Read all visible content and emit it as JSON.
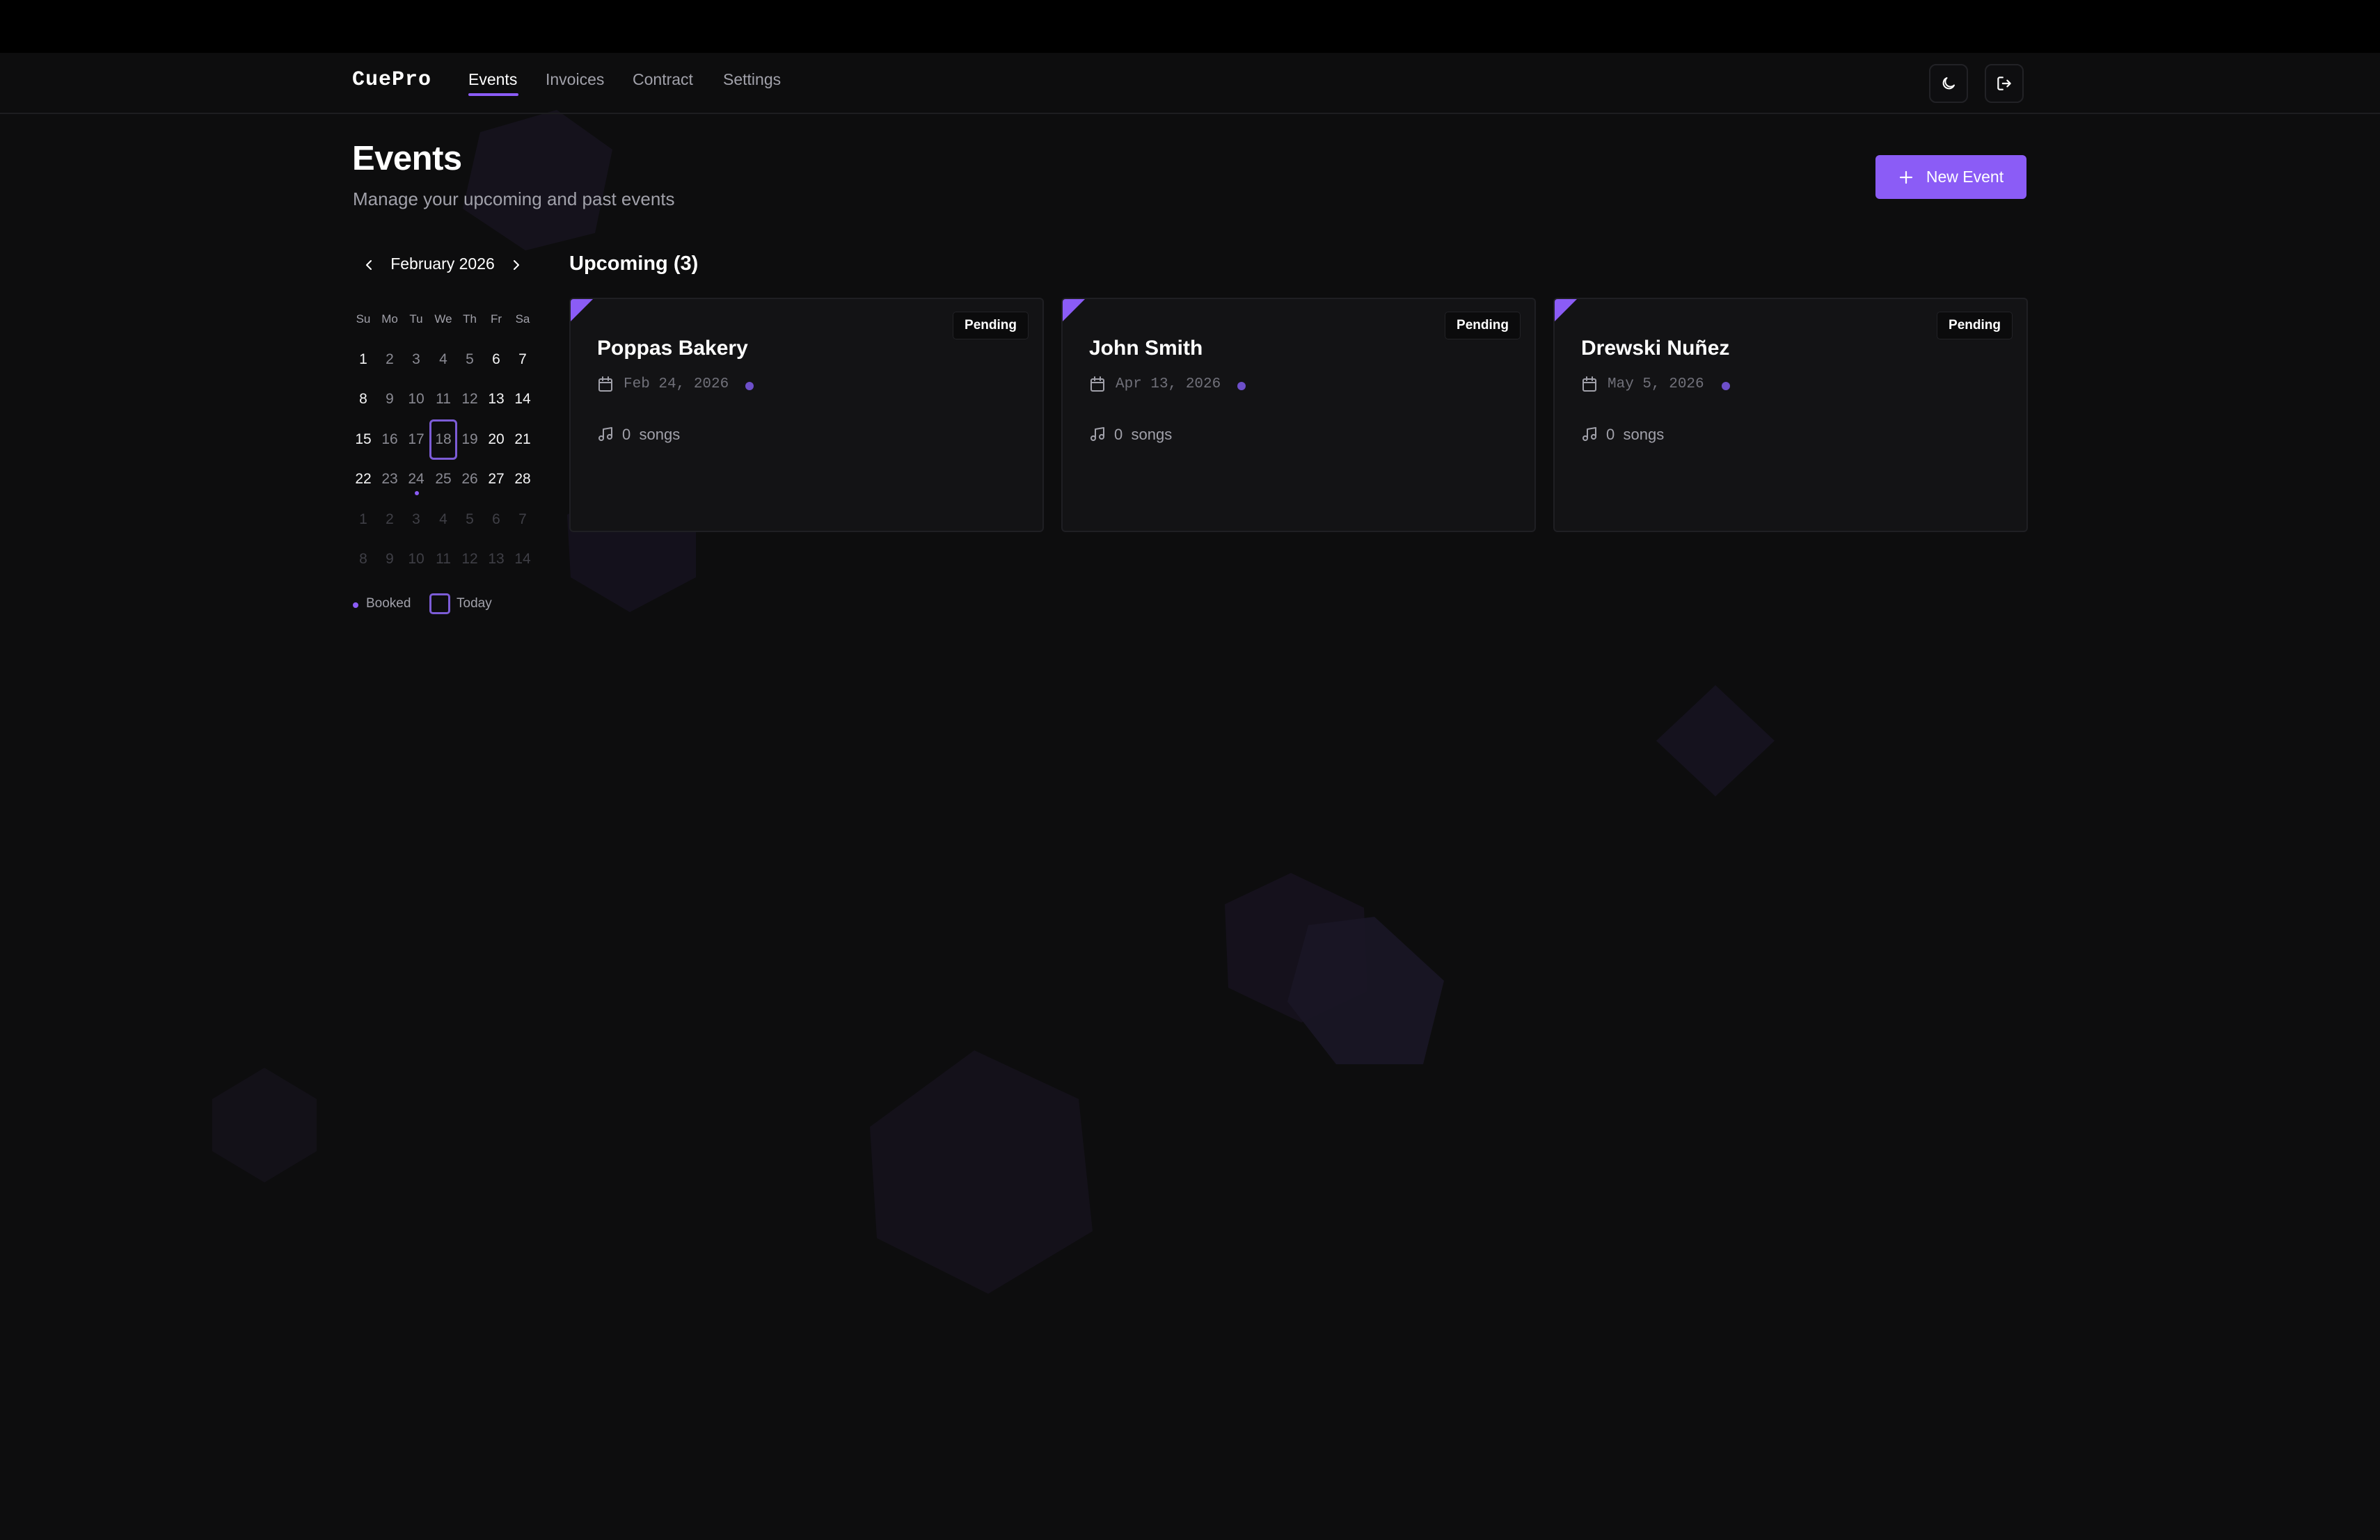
{
  "app": {
    "logo": "CuePro"
  },
  "nav": {
    "links": [
      {
        "label": "Events",
        "active": true
      },
      {
        "label": "Invoices",
        "active": false
      },
      {
        "label": "Contract",
        "active": false
      },
      {
        "label": "Settings",
        "active": false
      }
    ],
    "theme_icon": "moon-icon",
    "logout_icon": "logout-icon"
  },
  "header": {
    "title": "Events",
    "subtitle": "Manage your upcoming and past events",
    "new_event_label": "New Event",
    "new_event_icon": "plus-icon"
  },
  "calendar": {
    "month_label": "February 2026",
    "weekdays": [
      "Su",
      "Mo",
      "Tu",
      "We",
      "Th",
      "Fr",
      "Sa"
    ],
    "weeks": [
      [
        "1",
        "2",
        "3",
        "4",
        "5",
        "6",
        "7"
      ],
      [
        "8",
        "9",
        "10",
        "11",
        "12",
        "13",
        "14"
      ],
      [
        "15",
        "16",
        "17",
        "18",
        "19",
        "20",
        "21"
      ],
      [
        "22",
        "23",
        "24",
        "25",
        "26",
        "27",
        "28"
      ],
      [
        "1",
        "2",
        "3",
        "4",
        "5",
        "6",
        "7"
      ],
      [
        "8",
        "9",
        "10",
        "11",
        "12",
        "13",
        "14"
      ]
    ],
    "today": "18",
    "booked": [
      "24"
    ],
    "legend": {
      "booked": "Booked",
      "today": "Today"
    }
  },
  "events": {
    "section_title": "Upcoming (3)",
    "cards": [
      {
        "name": "Poppas Bakery",
        "date": "Feb 24, 2026",
        "status": "Pending",
        "songs_count": "0",
        "songs_label": "songs"
      },
      {
        "name": "John Smith",
        "date": "Apr 13, 2026",
        "status": "Pending",
        "songs_count": "0",
        "songs_label": "songs"
      },
      {
        "name": "Drewski Nuñez",
        "date": "May 5, 2026",
        "status": "Pending",
        "songs_count": "0",
        "songs_label": "songs"
      }
    ]
  },
  "colors": {
    "accent": "#8b5cf6",
    "background": "#0d0d0e",
    "card": "#131315"
  }
}
